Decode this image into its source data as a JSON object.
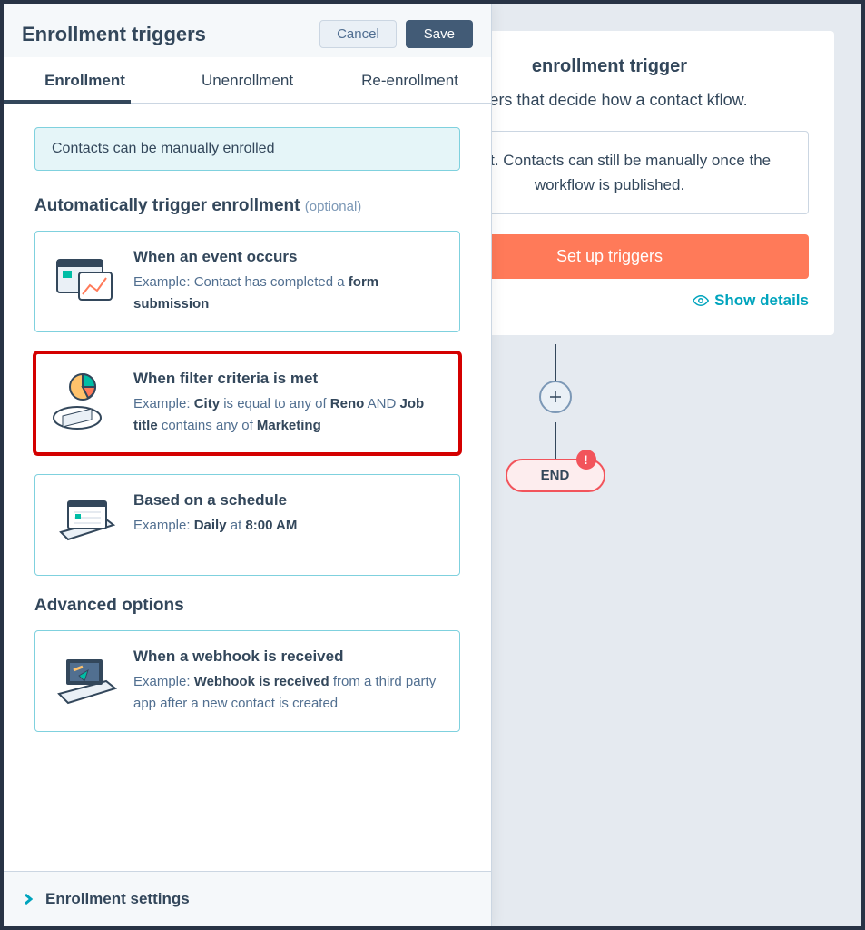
{
  "background": {
    "card_title": "enrollment trigger",
    "card_sub": "ggers that decide how a contact kflow.",
    "inner_box": "ers set. Contacts can still be manually once the workflow is published.",
    "setup_btn": "Set up triggers",
    "show_details": "Show details",
    "end_label": "END"
  },
  "panel": {
    "title": "Enrollment triggers",
    "buttons": {
      "cancel": "Cancel",
      "save": "Save"
    },
    "tabs": [
      "Enrollment",
      "Unenrollment",
      "Re-enrollment"
    ],
    "active_tab": 0,
    "banner": "Contacts can be manually enrolled",
    "auto_heading": "Automatically trigger enrollment",
    "auto_optional": "(optional)",
    "advanced_heading": "Advanced options",
    "triggers": [
      {
        "title": "When an event occurs",
        "example_prefix": "Example: Contact has completed a ",
        "example_bold": "form submission",
        "example_suffix": ""
      },
      {
        "title": "When filter criteria is met",
        "example_html": "Example: <b>City</b> is equal to any of <b>Reno</b> AND <b>Job title</b> contains any of <b>Marketing</b>"
      },
      {
        "title": "Based on a schedule",
        "example_prefix": "Example: ",
        "example_bold": "Daily",
        "example_suffix_plain": " at ",
        "example_bold2": "8:00 AM"
      }
    ],
    "advanced_trigger": {
      "title": "When a webhook is received",
      "example_prefix": "Example: ",
      "example_bold": "Webhook is received",
      "example_suffix": " from a third party app after a new contact is created"
    },
    "footer": "Enrollment settings"
  }
}
